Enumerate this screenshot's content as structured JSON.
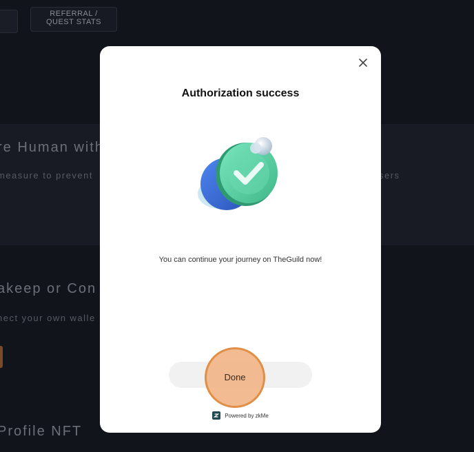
{
  "background": {
    "referral_button": "REFERRAL /\nQUEST STATS",
    "section1_heading": "re Human with",
    "section1_sub": "measure to prevent",
    "section1_sub_right": "sers",
    "section2_heading": "akeep or Con",
    "section2_sub": "nect your own walle",
    "section3_heading": "Profile NFT"
  },
  "modal": {
    "title": "Authorization success",
    "message": "You can continue your journey on TheGuild now!",
    "done_label": "Done",
    "powered_by": "Powered by zkMe",
    "close_icon": "close-icon",
    "illustration_icon": "checkmark-coin-icon",
    "colors": {
      "coin_green": "#5fd3a4",
      "coin_blue": "#3a6fd8",
      "done_highlight": "#e08f47"
    }
  }
}
